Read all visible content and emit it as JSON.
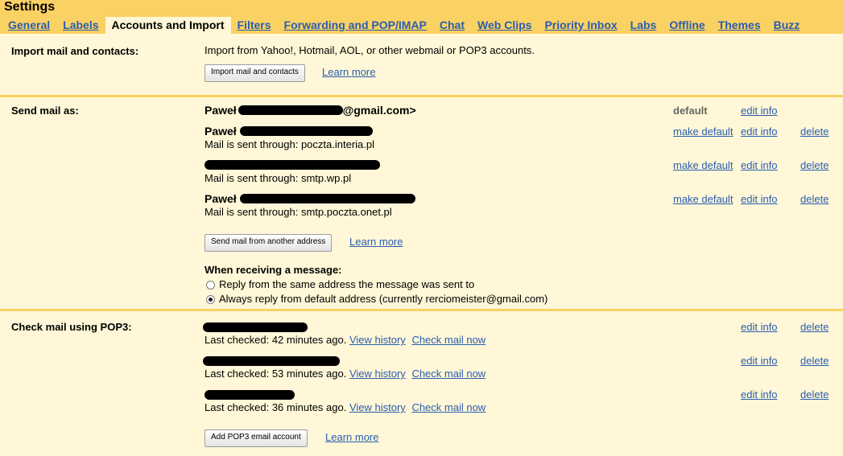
{
  "title": "Settings",
  "tabs": [
    "General",
    "Labels",
    "Accounts and Import",
    "Filters",
    "Forwarding and POP/IMAP",
    "Chat",
    "Web Clips",
    "Priority Inbox",
    "Labs",
    "Offline",
    "Themes",
    "Buzz"
  ],
  "import": {
    "label": "Import mail and contacts:",
    "description": "Import from Yahoo!, Hotmail, AOL, or other webmail or POP3 accounts.",
    "button": "Import mail and contacts",
    "learn_more": "Learn more"
  },
  "send": {
    "label": "Send mail as:",
    "primary": {
      "name_prefix": "Paweł",
      "email_suffix": "@gmail.com>",
      "status": "default",
      "edit": "edit info"
    },
    "accounts": [
      {
        "name": "Paweł",
        "via": "Mail is sent through: poczta.interia.pl",
        "make_default": "make default",
        "edit": "edit info",
        "delete": "delete"
      },
      {
        "name": "",
        "via": "Mail is sent through: smtp.wp.pl",
        "make_default": "make default",
        "edit": "edit info",
        "delete": "delete"
      },
      {
        "name": "Paweł",
        "via": "Mail is sent through: smtp.poczta.onet.pl",
        "make_default": "make default",
        "edit": "edit info",
        "delete": "delete"
      }
    ],
    "button": "Send mail from another address",
    "learn_more": "Learn more",
    "receiving_title": "When receiving a message:",
    "option_same": "Reply from the same address the message was sent to",
    "option_default": "Always reply from default address (currently rerciomeister@gmail.com)"
  },
  "pop3": {
    "label": "Check mail using POP3:",
    "accounts": [
      {
        "status": "Last checked: 42 minutes ago.",
        "history": "View history",
        "check": "Check mail now",
        "edit": "edit info",
        "delete": "delete"
      },
      {
        "status": "Last checked: 53 minutes ago.",
        "history": "View history",
        "check": "Check mail now",
        "edit": "edit info",
        "delete": "delete"
      },
      {
        "status": "Last checked: 36 minutes ago.",
        "history": "View history",
        "check": "Check mail now",
        "edit": "edit info",
        "delete": "delete"
      }
    ],
    "button": "Add POP3 email account",
    "learn_more": "Learn more"
  },
  "colors": {
    "header": "#fad163",
    "background": "#fff7d7",
    "link": "#2a5db0"
  }
}
